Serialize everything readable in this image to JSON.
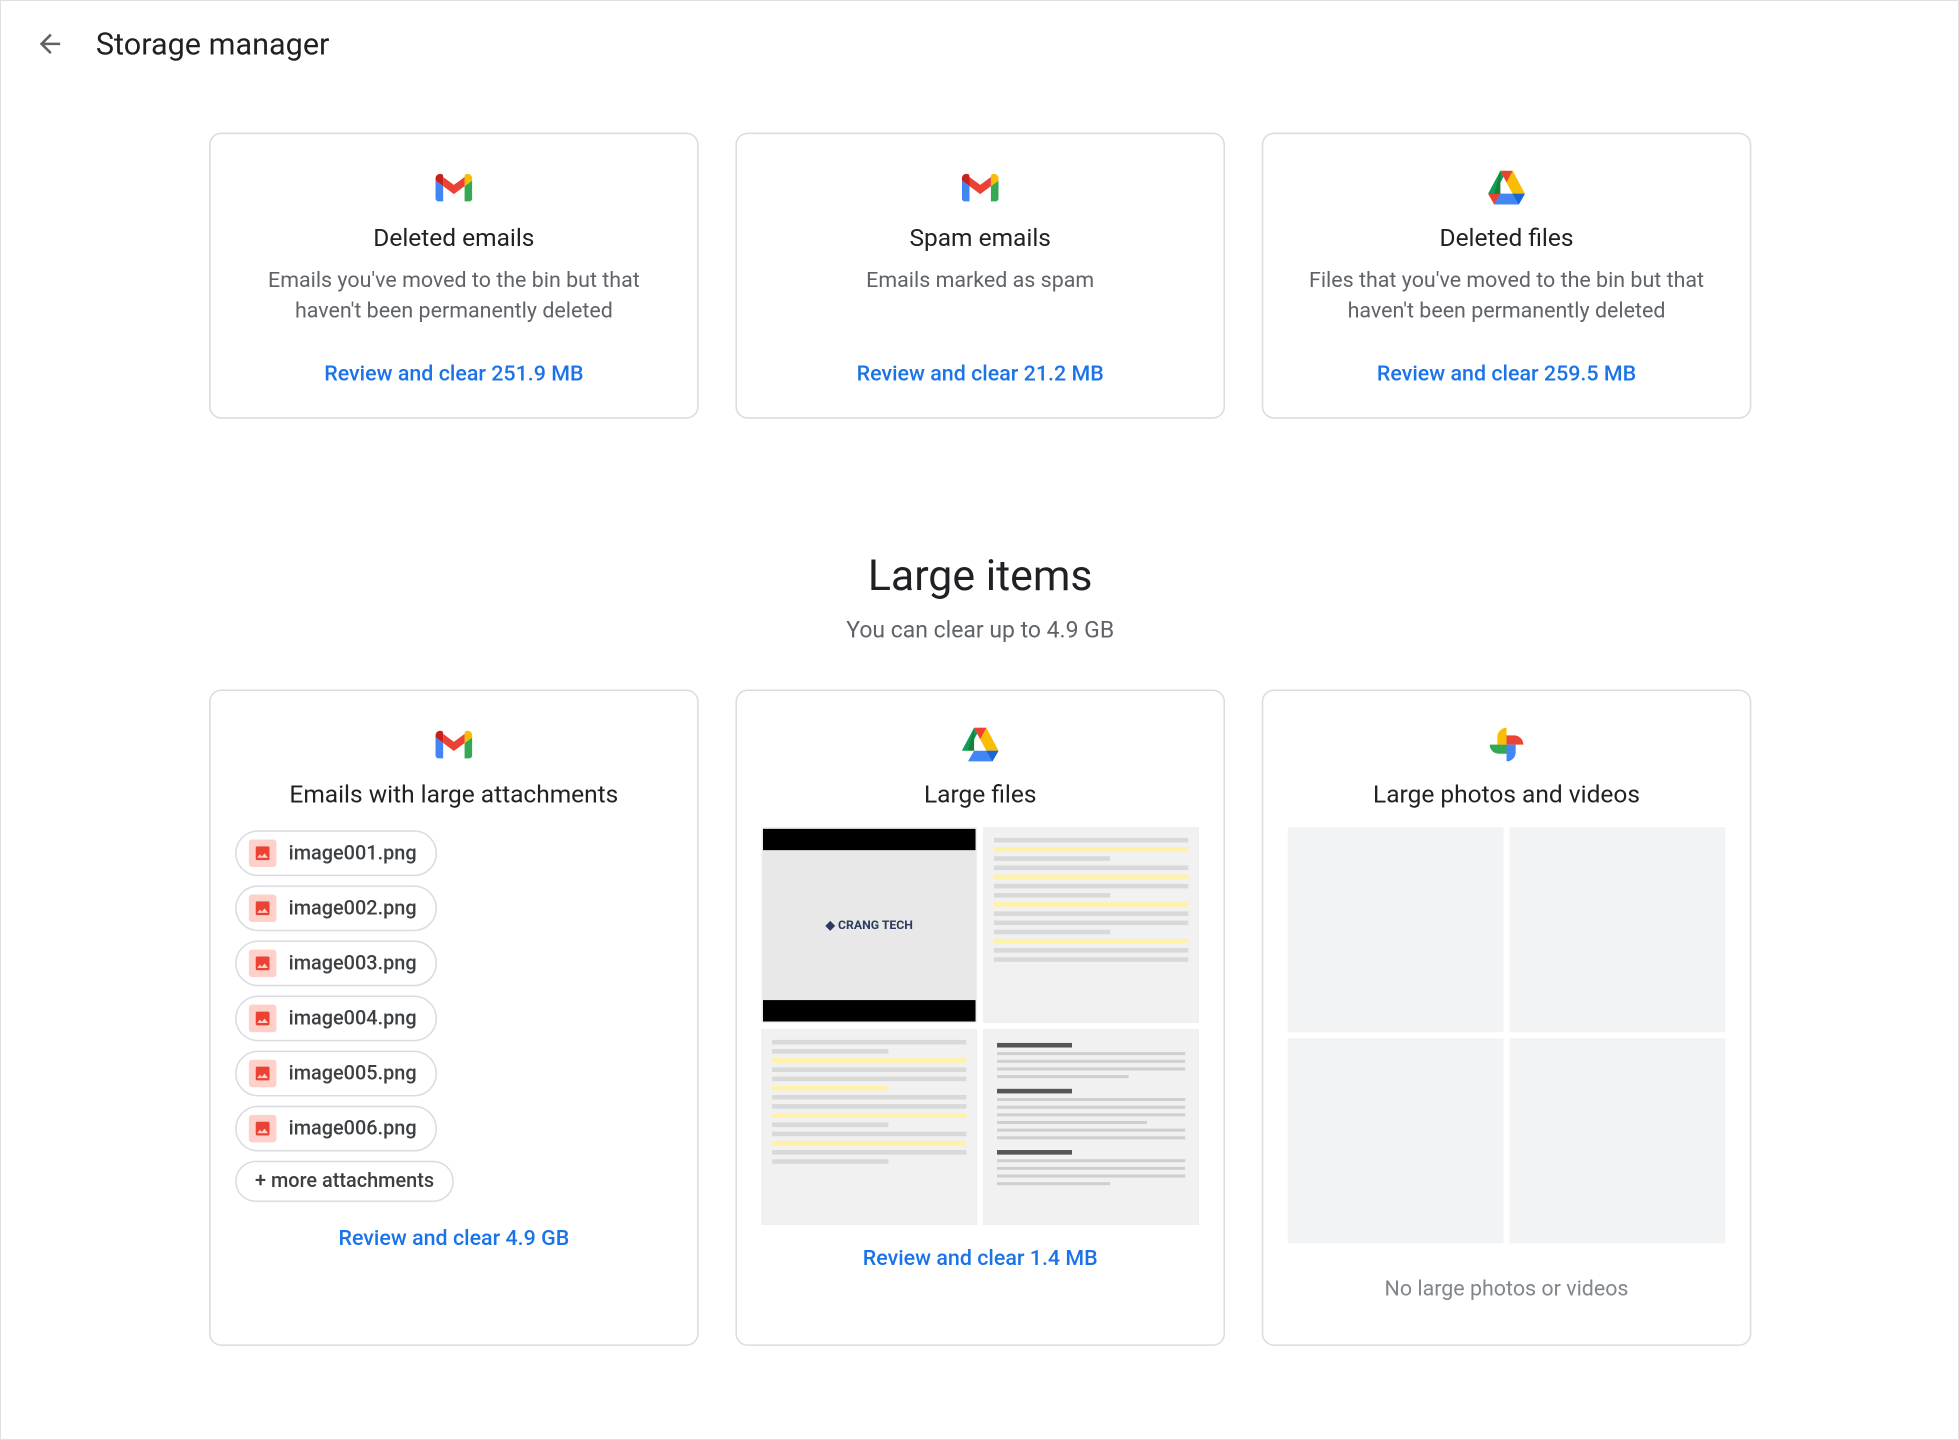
{
  "header": {
    "title": "Storage manager"
  },
  "top_cards": [
    {
      "icon": "gmail",
      "title": "Deleted emails",
      "desc": "Emails you've moved to the bin but that haven't been permanently deleted",
      "action": "Review and clear 251.9 MB"
    },
    {
      "icon": "gmail",
      "title": "Spam emails",
      "desc": "Emails marked as spam",
      "action": "Review and clear 21.2 MB"
    },
    {
      "icon": "drive",
      "title": "Deleted files",
      "desc": "Files that you've moved to the bin but that haven't been permanently deleted",
      "action": "Review and clear 259.5 MB"
    }
  ],
  "large_section": {
    "title": "Large items",
    "subtitle": "You can clear up to 4.9 GB"
  },
  "large_cards": {
    "attachments": {
      "icon": "gmail",
      "title": "Emails with large attachments",
      "chips": [
        "image001.png",
        "image002.png",
        "image003.png",
        "image004.png",
        "image005.png",
        "image006.png"
      ],
      "more": "+ more attachments",
      "action": "Review and clear 4.9 GB"
    },
    "large_files": {
      "icon": "drive",
      "title": "Large files",
      "action": "Review and clear 1.4 MB"
    },
    "photos": {
      "icon": "photos",
      "title": "Large photos and videos",
      "empty": "No large photos or videos"
    }
  }
}
